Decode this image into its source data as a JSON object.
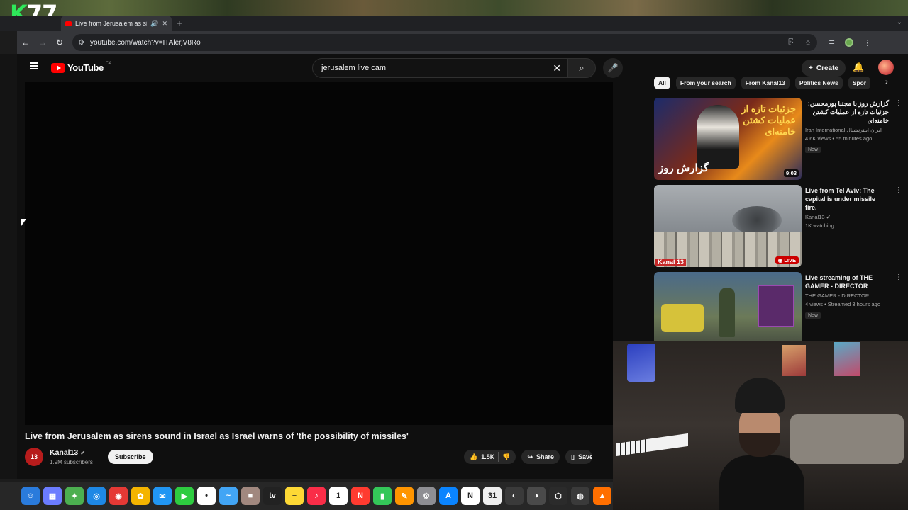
{
  "desktop": {
    "logo_k": "K",
    "logo_num": "77"
  },
  "browser": {
    "tab": {
      "title": "Live from Jerusalem as si",
      "sound_icon": "speaker-icon",
      "close_icon": "close-icon"
    },
    "new_tab_icon": "plus-icon",
    "url": "youtube.com/watch?v=ITAlerjV8Ro"
  },
  "youtube": {
    "logo_text": "YouTube",
    "region": "CA",
    "search": {
      "query": "jerusalem live cam"
    },
    "create_label": "Create",
    "video": {
      "title": "Live from Jerusalem as sirens sound in Israel as Israel warns of 'the possibility of missiles'",
      "channel": {
        "name": "Kanal13",
        "avatar_text": "13",
        "subscribers": "1.9M subscribers"
      },
      "subscribe_label": "Subscribe",
      "likes": "1.5K",
      "share_label": "Share",
      "save_label": "Save"
    },
    "chips": [
      "All",
      "From your search",
      "From Kanal13",
      "Politics News",
      "Spor"
    ],
    "recommendations": [
      {
        "title": "گزارش روز با مجتبا پورمحسن: جزئیات تازه از عملیات کشتن خامنه‌ای",
        "channel": "Iran International ایران اینترنشنال",
        "meta": "4.6K views • 55 minutes ago",
        "badge": "New",
        "duration": "9:03",
        "thumb_text_1": "جزئیات تازه از عملیات کشتن خامنه‌ای",
        "thumb_text_2": "گزارش روز"
      },
      {
        "title": "Live from Tel Aviv: The capital is under missile fire.",
        "channel": "Kanal13",
        "meta": "1K watching",
        "live_label": "LIVE",
        "thumb_brand": "Kanal 13"
      },
      {
        "title": "Live streaming of THE GAMER - DIRECTOR",
        "channel": "THE GAMER - DIRECTOR",
        "meta": "4 views • Streamed 3 hours ago",
        "badge": "New"
      }
    ]
  },
  "dock": {
    "icons": [
      {
        "name": "finder-icon",
        "color": "#2a7bdc",
        "glyph": "☺"
      },
      {
        "name": "launchpad-icon",
        "color": "#6b7cff",
        "glyph": "▦"
      },
      {
        "name": "app-icon",
        "color": "#4caf50",
        "glyph": "✦"
      },
      {
        "name": "safari-icon",
        "color": "#1e88e5",
        "glyph": "◎"
      },
      {
        "name": "chrome-icon",
        "color": "#e53935",
        "glyph": "◉"
      },
      {
        "name": "photos-icon",
        "color": "#f4b400",
        "glyph": "✿"
      },
      {
        "name": "mail-icon",
        "color": "#2196f3",
        "glyph": "✉"
      },
      {
        "name": "facetime-icon",
        "color": "#2ecc40",
        "glyph": "▶"
      },
      {
        "name": "reminders-icon",
        "color": "#ffffff",
        "glyph": "•"
      },
      {
        "name": "freeform-icon",
        "color": "#42a5f5",
        "glyph": "~"
      },
      {
        "name": "app2-icon",
        "color": "#a1887f",
        "glyph": "■"
      },
      {
        "name": "tv-icon",
        "color": "#222222",
        "glyph": "tv"
      },
      {
        "name": "notes-icon",
        "color": "#fdd835",
        "glyph": "≡"
      },
      {
        "name": "music-icon",
        "color": "#fa2d48",
        "glyph": "♪"
      },
      {
        "name": "calendar-icon",
        "color": "#ffffff",
        "glyph": "1"
      },
      {
        "name": "news-icon",
        "color": "#ff3b30",
        "glyph": "N"
      },
      {
        "name": "numbers-icon",
        "color": "#34c759",
        "glyph": "▮"
      },
      {
        "name": "pages-icon",
        "color": "#ff9500",
        "glyph": "✎"
      },
      {
        "name": "settings-icon",
        "color": "#8e8e93",
        "glyph": "⚙"
      },
      {
        "name": "appstore-icon",
        "color": "#0a84ff",
        "glyph": "A"
      },
      {
        "name": "notion-icon",
        "color": "#ffffff",
        "glyph": "N"
      },
      {
        "name": "calendar2-icon",
        "color": "#eeeeee",
        "glyph": "31"
      },
      {
        "name": "app3-icon",
        "color": "#3a3a3a",
        "glyph": "◐"
      },
      {
        "name": "app4-icon",
        "color": "#4a4a4a",
        "glyph": "◑"
      },
      {
        "name": "app5-icon",
        "color": "#2b2b2b",
        "glyph": "⬡"
      },
      {
        "name": "app6-icon",
        "color": "#3a3a3a",
        "glyph": "◍"
      },
      {
        "name": "app7-icon",
        "color": "#ff6f00",
        "glyph": "▲"
      }
    ]
  }
}
